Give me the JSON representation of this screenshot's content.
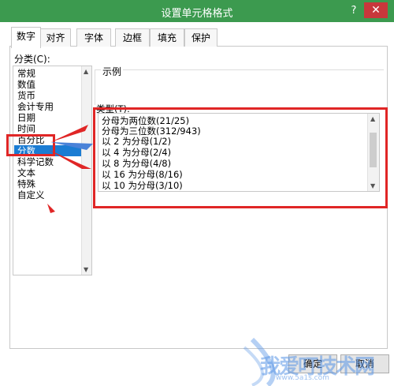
{
  "window": {
    "title": "设置单元格格式",
    "help": "?",
    "close": "✕"
  },
  "tabs": [
    "数字",
    "对齐",
    "字体",
    "边框",
    "填充",
    "保护"
  ],
  "category": {
    "label": "分类(C):",
    "items": [
      "常规",
      "数值",
      "货币",
      "会计专用",
      "日期",
      "时间",
      "百分比",
      "分数",
      "科学记数",
      "文本",
      "特殊",
      "自定义"
    ],
    "selected": "分数"
  },
  "sample_label": "示例",
  "type": {
    "label": "类型(T):",
    "items": [
      "分母为两位数(21/25)",
      "分母为三位数(312/943)",
      "以 2 为分母(1/2)",
      "以 4 为分母(2/4)",
      "以 8 为分母(4/8)",
      "以 16 为分母(8/16)",
      "以 10 为分母(3/10)"
    ]
  },
  "buttons": {
    "ok": "确定",
    "cancel": "取消"
  },
  "watermark": {
    "text": "我爱叮技术网",
    "url": "www.5a1s.com"
  },
  "colors": {
    "titlebar": "#3c9a4f",
    "selection": "#1b7cd3",
    "highlight": "#e02626"
  }
}
